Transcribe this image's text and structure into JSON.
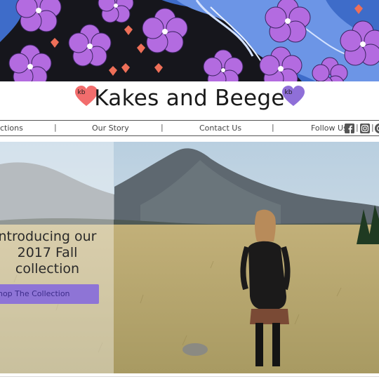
{
  "site": {
    "title": "Kakes and Beege",
    "badge_left": "kb",
    "badge_right": "kb"
  },
  "nav": {
    "items": [
      "ctions",
      "Our Story",
      "Contact Us"
    ],
    "follow_label": "Follow Us",
    "social_icons": [
      "facebook-icon",
      "instagram-icon",
      "pinterest-icon"
    ]
  },
  "hero": {
    "line1": "ntroducing our",
    "line2": "2017 Fall",
    "line3": "collection",
    "cta_label": "Shop The Collection"
  },
  "colors": {
    "heart_left": "#f26d6d",
    "heart_right": "#8f6fd8",
    "cta_bg": "#8e74d6",
    "cta_text": "#3d2c8a",
    "banner_flowers": "#b36be0"
  }
}
